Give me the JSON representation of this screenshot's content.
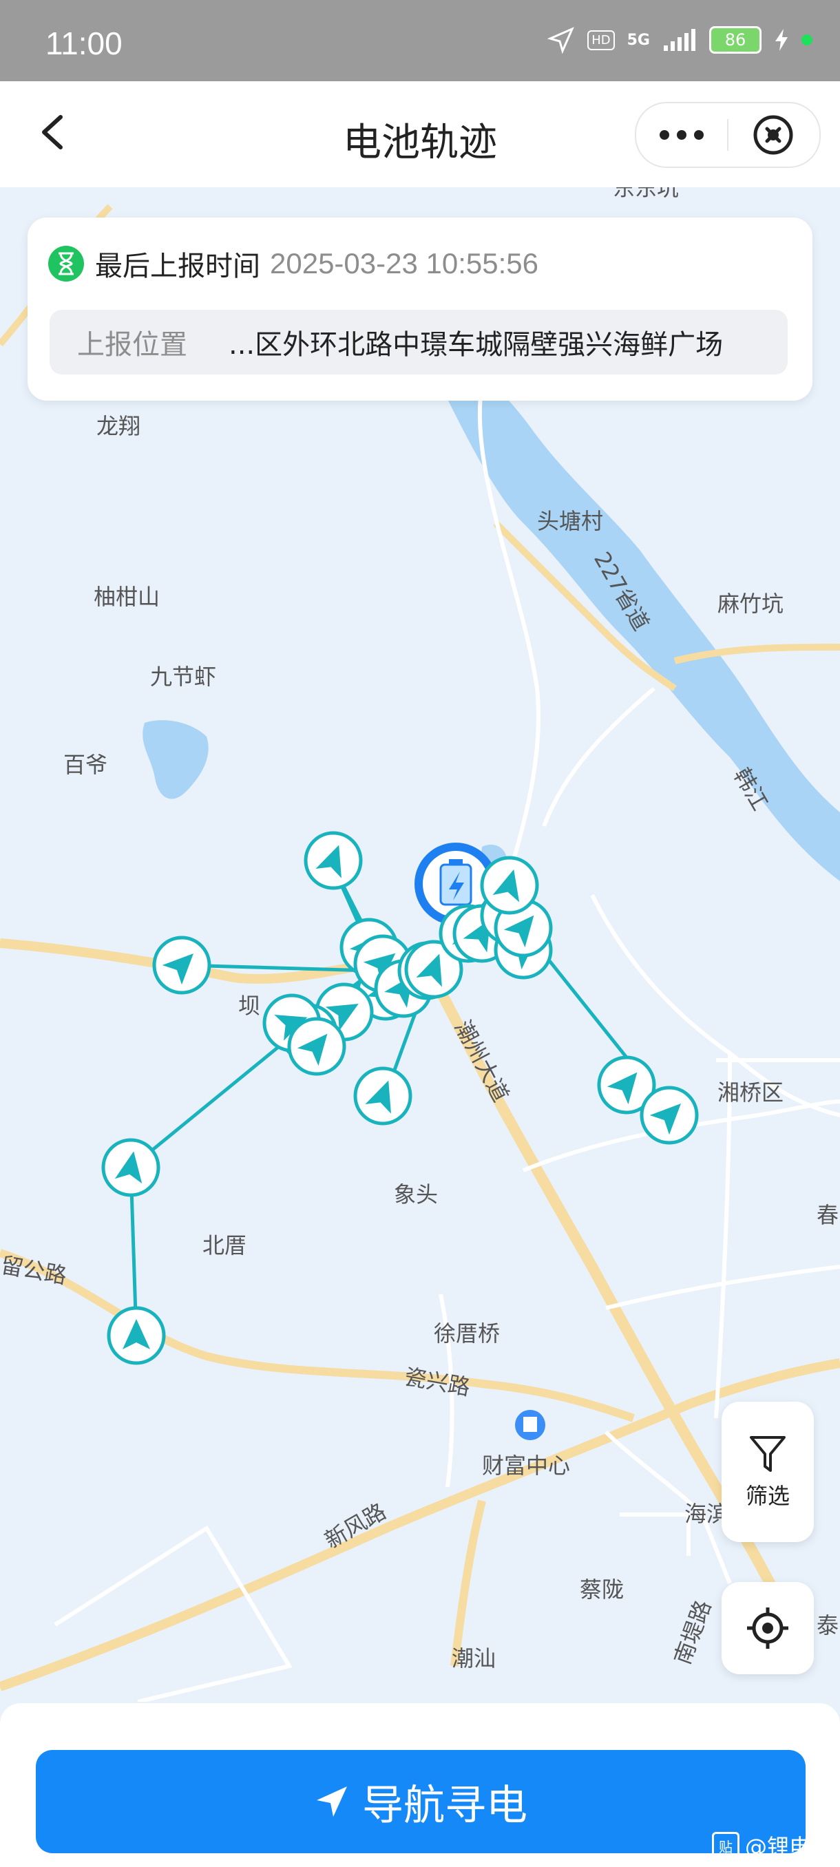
{
  "status_bar": {
    "time": "11:00",
    "network": "5G",
    "hd_badge": "HD",
    "battery_level": "86"
  },
  "header": {
    "title": "电池轨迹",
    "more_icon": "more-dots-icon",
    "close_icon": "close-circle-icon",
    "back_icon": "chevron-left-icon"
  },
  "info_card": {
    "time_label": "最后上报时间",
    "time_value": "2025-03-23 10:55:56",
    "location_label": "上报位置",
    "location_value": "...区外环北路中璟车城隔壁强兴海鲜广场"
  },
  "map": {
    "place_labels": [
      "龙翔",
      "头塘村",
      "柚柑山",
      "麻竹坑",
      "九节虾",
      "百爷",
      "韩江",
      "湘桥区",
      "象头",
      "北厝",
      "春",
      "徐厝桥",
      "瓷兴路",
      "财富中心",
      "新风路",
      "海滨",
      "蔡陇",
      "泰",
      "潮汕",
      "南堤路",
      "潮州大道",
      "227省道",
      "坝",
      "留公路",
      "东东坑"
    ],
    "colors": {
      "track": "#19b3bd",
      "water": "#a9d4f5",
      "land": "#e9f1fb",
      "road_major": "#f6dca0",
      "road_minor": "#ffffff"
    }
  },
  "controls": {
    "filter_label": "筛选",
    "filter_icon": "funnel-icon",
    "locate_icon": "crosshair-icon"
  },
  "bottom": {
    "nav_button_label": "导航寻电",
    "nav_icon": "navigation-arrow-icon"
  },
  "watermark": {
    "badge": "贴",
    "text": "@锂电池"
  }
}
